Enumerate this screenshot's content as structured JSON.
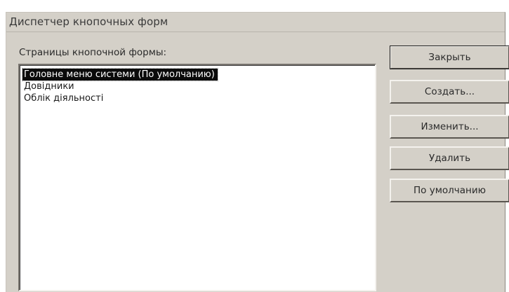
{
  "window": {
    "title": "Диспетчер кнопочных форм"
  },
  "list": {
    "label": "Страницы кнопочной формы:",
    "items": [
      "Головне меню системи (По умолчанию)",
      "Довідники",
      "Облік діяльності"
    ],
    "selected_index": 0
  },
  "buttons": {
    "close": "Закрыть",
    "create": "Создать...",
    "edit": "Изменить...",
    "delete": "Удалить",
    "default": "По умолчанию"
  },
  "colors": {
    "dialog_bg": "#d4d0c8",
    "selection_bg": "#0a0a0a",
    "selection_fg": "#ffffff"
  }
}
